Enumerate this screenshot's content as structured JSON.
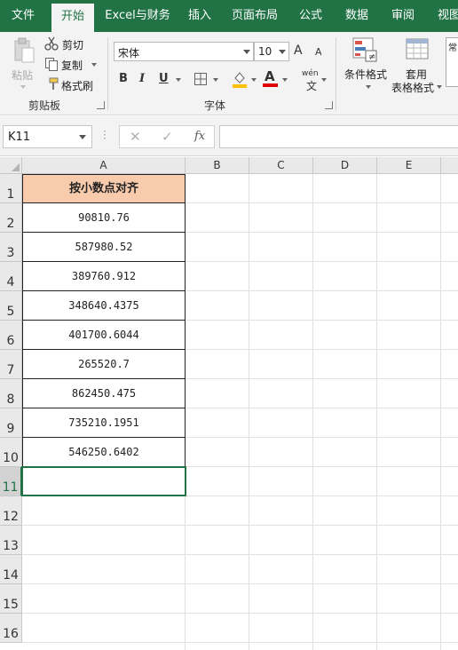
{
  "tabs": [
    "文件",
    "开始",
    "Excel与财务",
    "插入",
    "页面布局",
    "公式",
    "数据",
    "审阅",
    "视图"
  ],
  "clipboard": {
    "paste": "粘贴",
    "cut": "剪切",
    "copy": "复制",
    "format_painter": "格式刷",
    "group_label": "剪贴板"
  },
  "font": {
    "name": "宋体",
    "size": "10",
    "grow": "A",
    "shrink": "A",
    "bold": "B",
    "italic": "I",
    "underline": "U",
    "font_color": "A",
    "wen": "wén",
    "wen_char": "文",
    "group_label": "字体"
  },
  "styles": {
    "conditional_format": "条件格式",
    "format_as_table_1": "套用",
    "format_as_table_2": "表格格式",
    "partial": "常"
  },
  "formula_bar": {
    "name_box": "K11",
    "cancel": "✕",
    "enter": "✓",
    "fx": "fx",
    "value": ""
  },
  "sheet": {
    "columns": [
      "A",
      "B",
      "C",
      "D",
      "E"
    ],
    "rows": [
      "1",
      "2",
      "3",
      "4",
      "5",
      "6",
      "7",
      "8",
      "9",
      "10",
      "11",
      "12",
      "13",
      "14",
      "15",
      "16"
    ],
    "active_row": "11",
    "header_cell": "按小数点对齐",
    "values": [
      "90810.76",
      "587980.52",
      "389760.912",
      "348640.4375",
      "401700.6044",
      "265520.7",
      "862450.475",
      "735210.1951",
      "546250.6402"
    ],
    "header_fill": "#f8cbad",
    "accent": "#217346"
  }
}
